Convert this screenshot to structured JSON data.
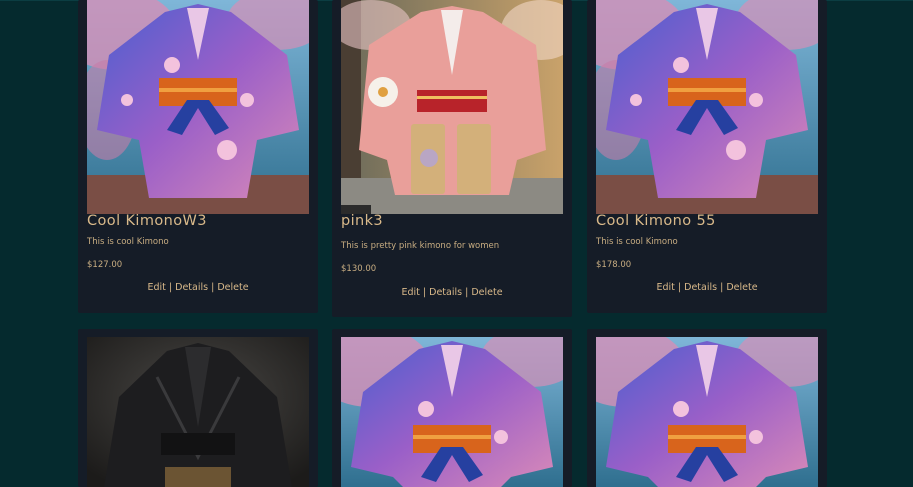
{
  "products": [
    {
      "title": "Cool KimonoW3",
      "description": "This is cool Kimono",
      "price": "$127.00",
      "image": "purple-kimono"
    },
    {
      "title": "pink3",
      "description": "This is pretty pink kimono for women",
      "price": "$130.00",
      "image": "pink-kimono"
    },
    {
      "title": "Cool Kimono 55",
      "description": "This is cool Kimono",
      "price": "$178.00",
      "image": "purple-kimono"
    },
    {
      "image": "black-kimono"
    },
    {
      "image": "purple-kimono"
    },
    {
      "image": "purple-kimono"
    }
  ],
  "actions": {
    "edit": "Edit",
    "details": "Details",
    "delete": "Delete",
    "separator": "|"
  },
  "colors": {
    "page_bg": "#052a2e",
    "card_bg": "#151c27",
    "text_gold": "#d9b98a"
  }
}
